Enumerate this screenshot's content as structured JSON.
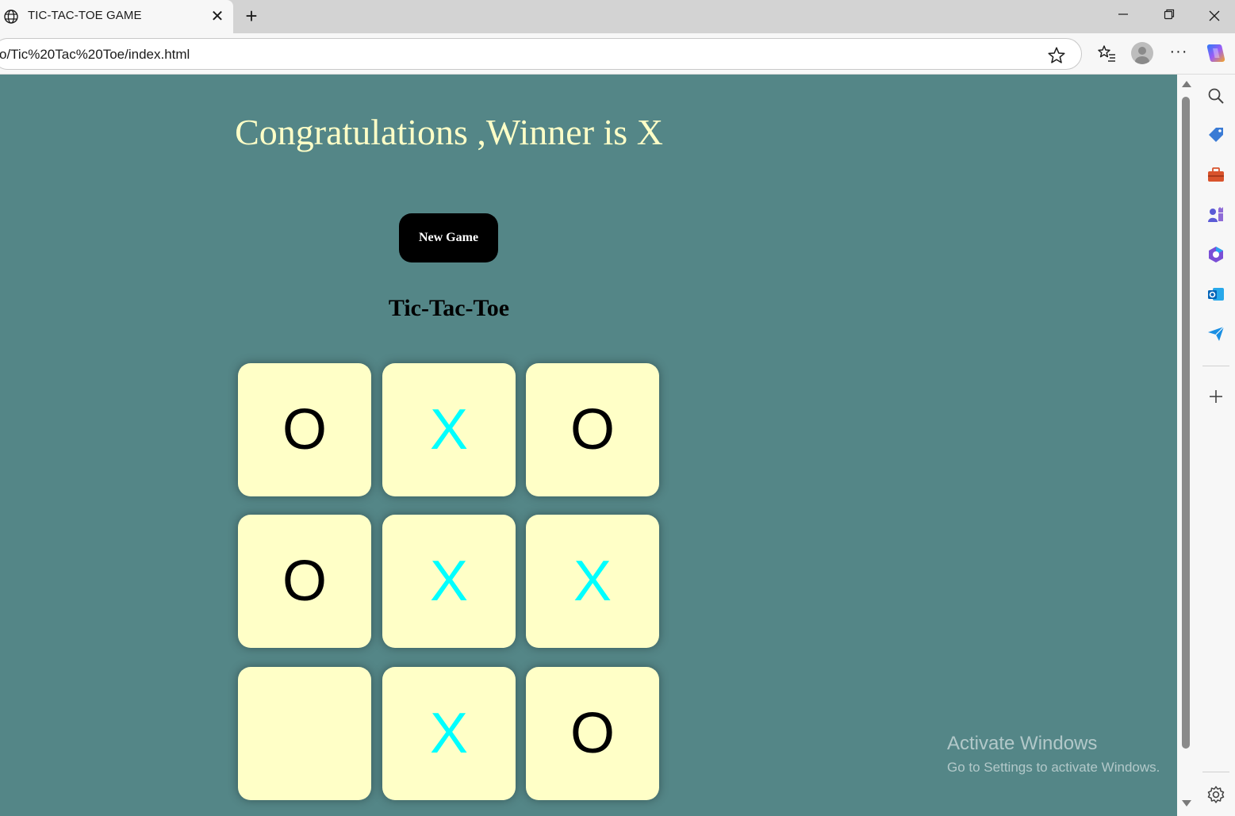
{
  "browser": {
    "tab_title": "TIC-TAC-TOE GAME",
    "url": "o/Tic%20Tac%20Toe/index.html",
    "sidebar_icons": [
      "search-icon",
      "tag-icon",
      "toolbox-icon",
      "games-icon",
      "microsoft365-icon",
      "outlook-icon",
      "send-icon",
      "add-icon",
      "settings-icon"
    ]
  },
  "page": {
    "message": "Congratulations ,Winner is X",
    "new_game_label": "New Game",
    "title": "Tic-Tac-Toe",
    "board": [
      "O",
      "X",
      "O",
      "O",
      "X",
      "X",
      "",
      "X",
      "O"
    ],
    "colors": {
      "background": "#548687",
      "cell": "#ffffc7",
      "x_mark": "#00ffff",
      "o_mark": "#000000",
      "message": "#ffffc7"
    }
  },
  "watermark": {
    "title": "Activate Windows",
    "subtitle": "Go to Settings to activate Windows."
  }
}
